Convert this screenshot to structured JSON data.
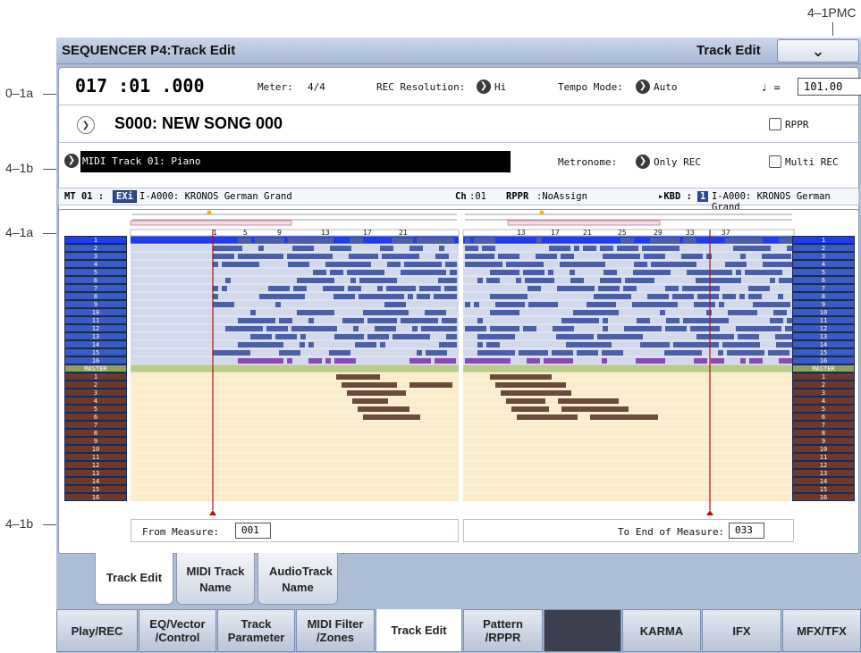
{
  "callouts": {
    "pmc": "4–1PMC",
    "a1": "0–1a",
    "b1": "4–1b",
    "a2": "4–1a",
    "b2": "4–1b"
  },
  "header": {
    "title": "SEQUENCER P4:Track Edit",
    "menu_label": "Track Edit",
    "menu_icon": "chevron-down-icon"
  },
  "location": {
    "value": "017 :01 .000"
  },
  "meter": {
    "label": "Meter:",
    "value": "4/4"
  },
  "rec_resolution": {
    "label": "REC Resolution:",
    "value": "Hi"
  },
  "tempo_mode": {
    "label": "Tempo Mode:",
    "value": "Auto"
  },
  "tempo": {
    "label": "♩ =",
    "value": "101.00"
  },
  "song": {
    "name": "S000: NEW SONG 000"
  },
  "rppr_check": {
    "label": "RPPR"
  },
  "track_select": {
    "value": "MIDI Track 01: Piano"
  },
  "metronome": {
    "label": "Metronome:",
    "value": "Only REC"
  },
  "multi_rec": {
    "label": "Multi REC"
  },
  "info": {
    "track": "MT 01 :",
    "bank_badge": "EXi",
    "program": "I-A000: KRONOS German Grand",
    "ch_label": "Ch",
    "ch_value": ":01",
    "rppr_label": "RPPR",
    "rppr_value": ":NoAssign",
    "kbd_label": "▸KBD :",
    "kbd_badge": "1",
    "kbd_program": "I-A000: KRONOS German Grand"
  },
  "ruler_left": [
    "1",
    "5",
    "9",
    "13",
    "17",
    "21"
  ],
  "ruler_right": [
    "13",
    "17",
    "21",
    "25",
    "29",
    "33",
    "37"
  ],
  "midi_tracks": [
    "1",
    "2",
    "3",
    "4",
    "5",
    "6",
    "7",
    "8",
    "9",
    "10",
    "11",
    "12",
    "13",
    "14",
    "15",
    "16"
  ],
  "master_label": "MASTER",
  "audio_tracks": [
    "1",
    "2",
    "3",
    "4",
    "5",
    "6",
    "7",
    "8",
    "9",
    "10",
    "11",
    "12",
    "13",
    "14",
    "15",
    "16"
  ],
  "from_measure": {
    "label": "From Measure:",
    "value": "001"
  },
  "to_end": {
    "label": "To End of Measure:",
    "value": "033"
  },
  "sub_tabs": [
    "Track Edit",
    "MIDI Track Name",
    "AudioTrack Name"
  ],
  "main_tabs": [
    "Play/REC",
    "EQ/Vector /Control",
    "Track Parameter",
    "MIDI Filter /Zones",
    "Track Edit",
    "Pattern /RPPR",
    "",
    "KARMA",
    "IFX",
    "MFX/TFX"
  ],
  "colors": {
    "midi_track": "#3a5bbf",
    "selected_track": "#1f3cf0",
    "audio_track": "#6b3a2c",
    "master": "#b9cc8a",
    "midi_area": "#d3d9ec",
    "audio_area": "#fbeccb",
    "event_midi": "#4b5fa6",
    "event_audio": "#6c4a3c",
    "event_master": "#8a48b8",
    "playhead": "#b01010"
  }
}
